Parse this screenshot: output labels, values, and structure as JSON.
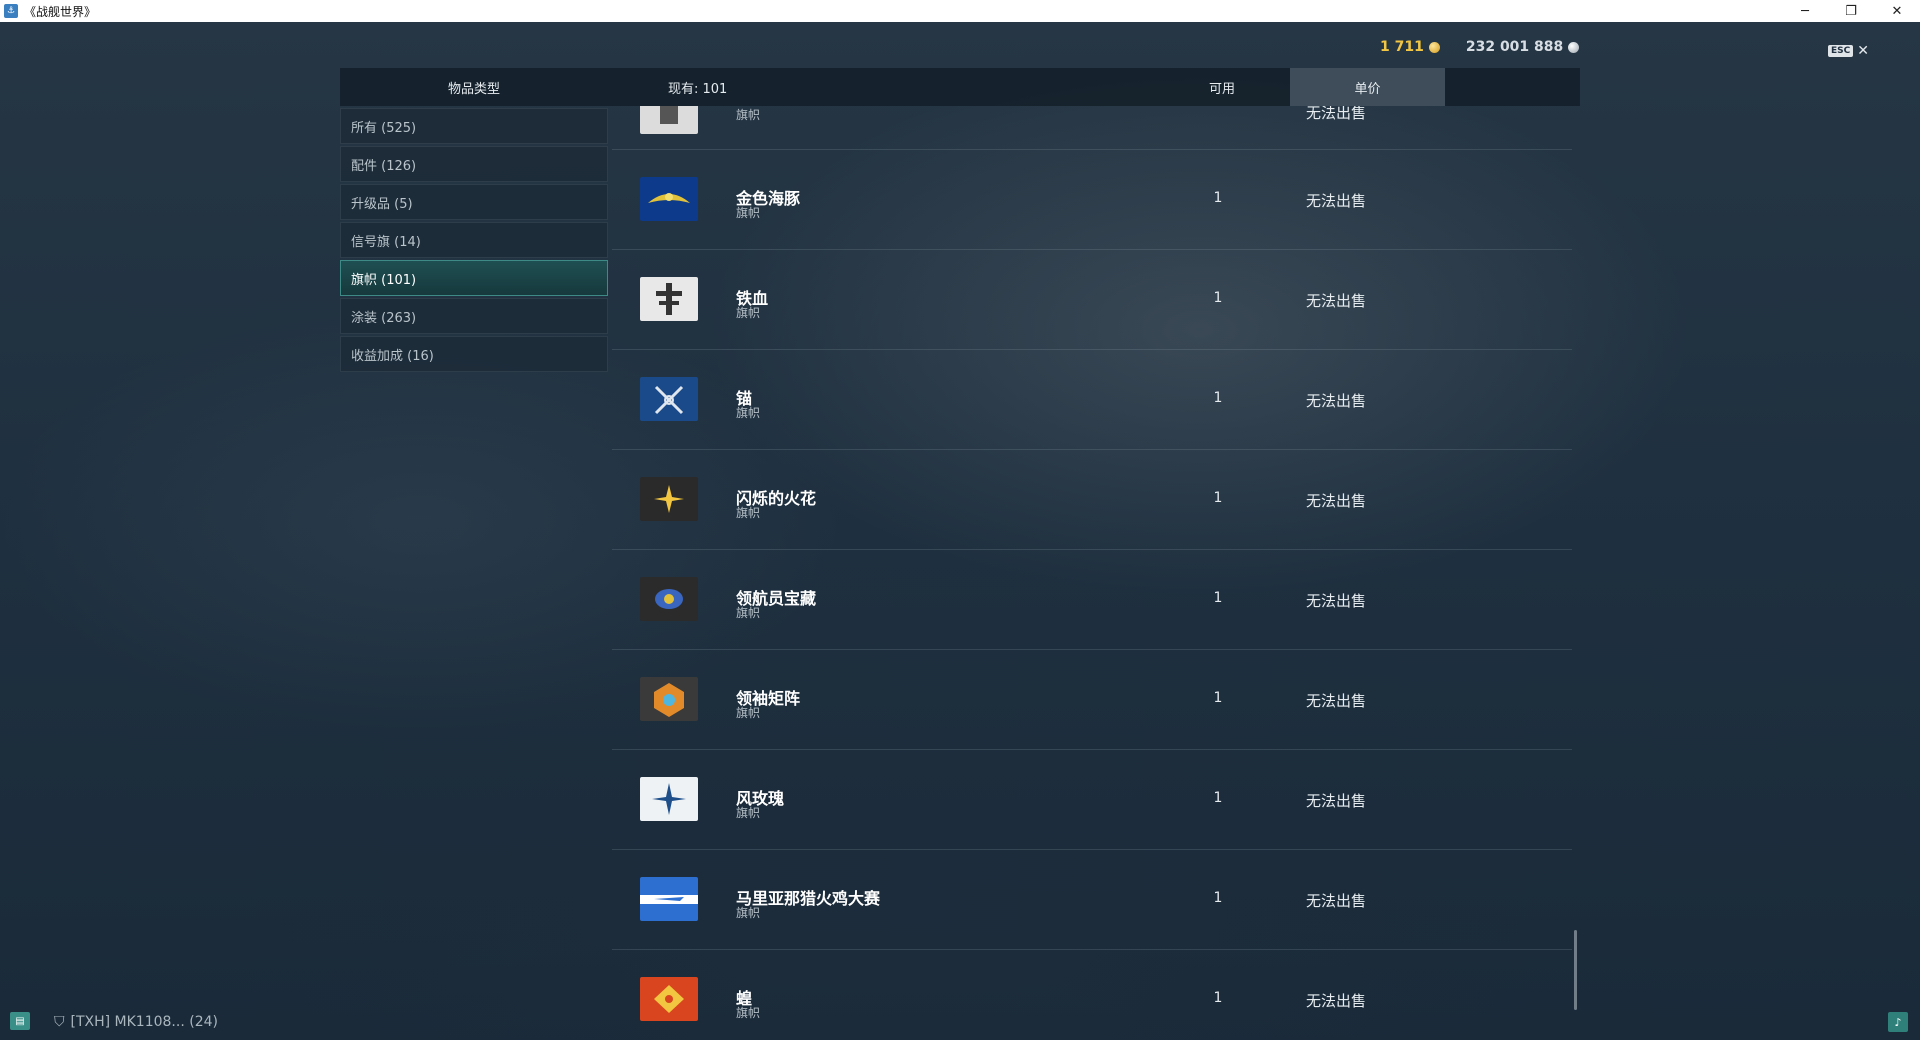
{
  "window": {
    "title": "《战舰世界》",
    "minimize": "─",
    "restore": "❐",
    "close": "✕"
  },
  "currency": {
    "doubloons": "1 711",
    "credits": "232 001 888"
  },
  "esc": {
    "key": "ESC",
    "close": "✕"
  },
  "header": {
    "item_type": "物品类型",
    "owned": "现有: 101",
    "available": "可用",
    "unit_price": "单价"
  },
  "sidebar": {
    "items": [
      {
        "label": "所有 (525)"
      },
      {
        "label": "配件 (126)"
      },
      {
        "label": "升级品 (5)"
      },
      {
        "label": "信号旗 (14)"
      },
      {
        "label": "旗帜 (101)",
        "active": true
      },
      {
        "label": "涂装 (263)"
      },
      {
        "label": "收益加成 (16)"
      }
    ]
  },
  "list": {
    "partial_row": {
      "sub": "旗帜",
      "qty": "",
      "price": "无法出售"
    },
    "rows": [
      {
        "name": "金色海豚",
        "sub": "旗帜",
        "qty": "1",
        "price": "无法出售",
        "icon": "golden-dolphin-flag-icon",
        "colors": [
          "#0d3a8a",
          "#e2c23a"
        ]
      },
      {
        "name": "铁血",
        "sub": "旗帜",
        "qty": "1",
        "price": "无法出售",
        "icon": "iron-blood-flag-icon",
        "colors": [
          "#e8e8e8",
          "#333333"
        ]
      },
      {
        "name": "锚",
        "sub": "旗帜",
        "qty": "1",
        "price": "无法出售",
        "icon": "anchor-flag-icon",
        "colors": [
          "#1a4a8a",
          "#e0e6ee"
        ]
      },
      {
        "name": "闪烁的火花",
        "sub": "旗帜",
        "qty": "1",
        "price": "无法出售",
        "icon": "sparkle-flag-icon",
        "colors": [
          "#2a2a2a",
          "#f2c640"
        ]
      },
      {
        "name": "领航员宝藏",
        "sub": "旗帜",
        "qty": "1",
        "price": "无法出售",
        "icon": "navigator-treasure-flag-icon",
        "colors": [
          "#2b2b2b",
          "#3a66c0"
        ]
      },
      {
        "name": "领袖矩阵",
        "sub": "旗帜",
        "qty": "1",
        "price": "无法出售",
        "icon": "leader-matrix-flag-icon",
        "colors": [
          "#3a3a3a",
          "#e28a2a"
        ]
      },
      {
        "name": "风玫瑰",
        "sub": "旗帜",
        "qty": "1",
        "price": "无法出售",
        "icon": "wind-rose-flag-icon",
        "colors": [
          "#eef2f5",
          "#1e4f8a"
        ]
      },
      {
        "name": "马里亚那猎火鸡大赛",
        "sub": "旗帜",
        "qty": "1",
        "price": "无法出售",
        "icon": "marianas-turkey-shoot-flag-icon",
        "colors": [
          "#2d6fd0",
          "#ffffff"
        ]
      },
      {
        "name": "蝗",
        "sub": "旗帜",
        "qty": "1",
        "price": "无法出售",
        "icon": "locust-flag-icon",
        "colors": [
          "#d8451e",
          "#f2c640"
        ]
      }
    ]
  },
  "bottom": {
    "chat_icon": "chat-icon",
    "clan_text": "[TXH]  MK1108...  (24)",
    "notification_icon": "bell-icon"
  }
}
